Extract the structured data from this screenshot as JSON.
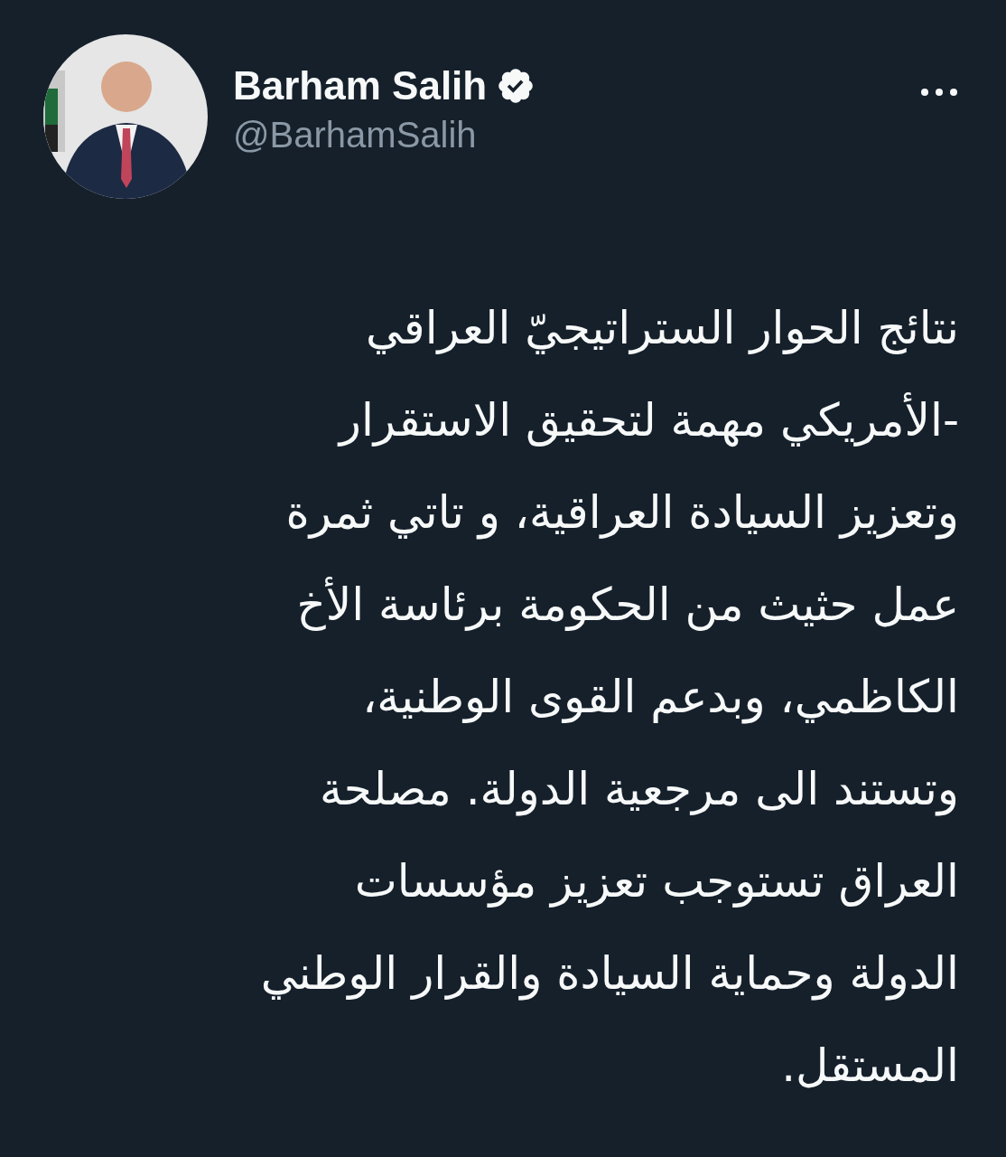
{
  "author": {
    "name": "Barham Salih",
    "verified": true,
    "handle": "@BarhamSalih"
  },
  "tweet": {
    "text": "نتائج الحوار الستراتيجيّ العراقي\n-الأمريكي مهمة لتحقيق الاستقرار\nوتعزيز السيادة العراقية، و تاتي ثمرة\nعمل حثيث من الحكومة برئاسة الأخ\nالكاظمي، وبدعم القوى الوطنية،\nوتستند الى مرجعية الدولة. مصلحة\nالعراق تستوجب تعزيز مؤسسات\nالدولة وحماية السيادة والقرار الوطني\nالمستقل."
  }
}
